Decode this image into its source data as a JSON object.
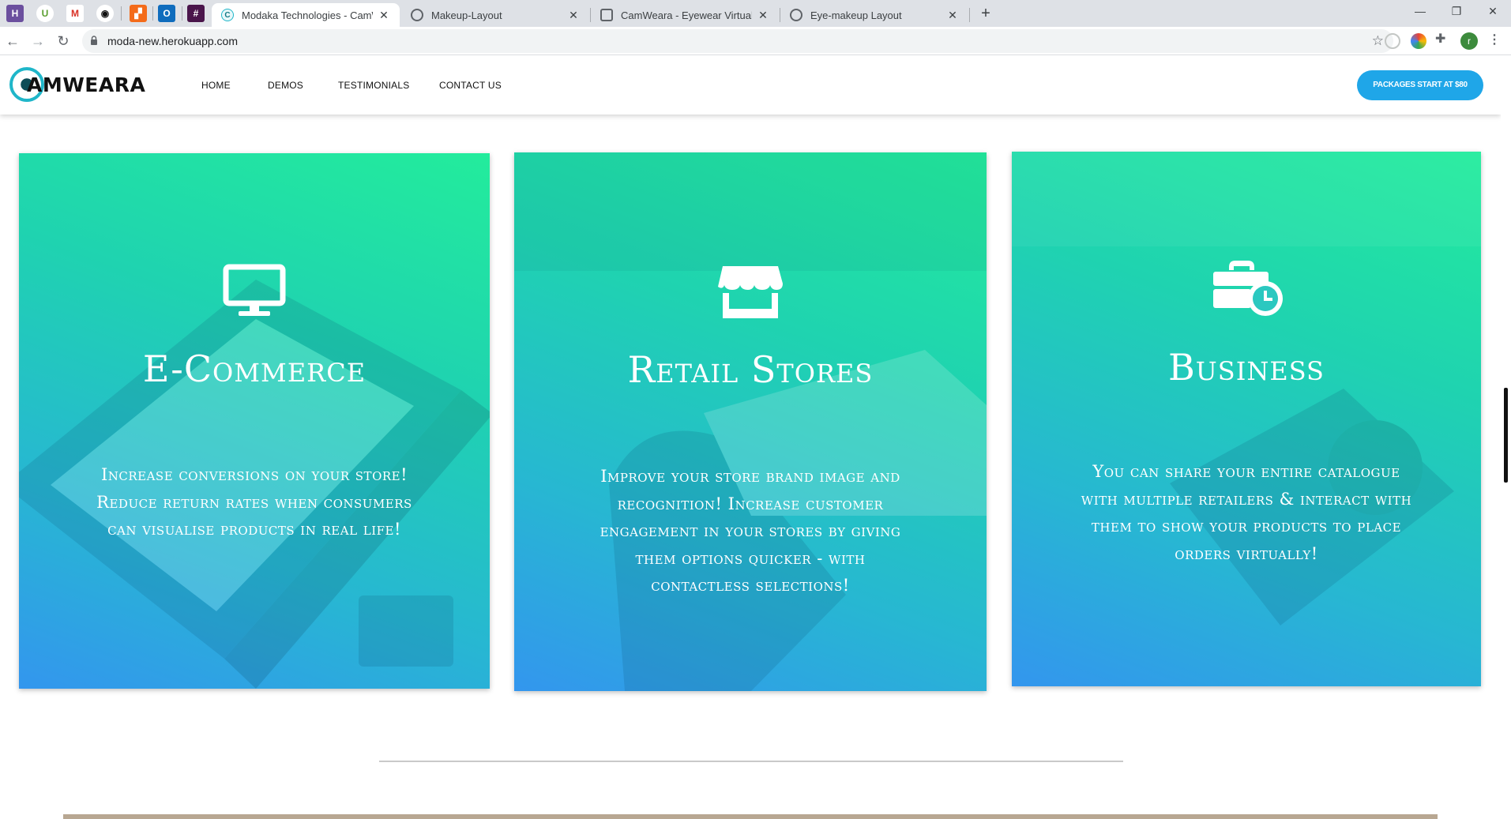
{
  "browser": {
    "tabs": [
      {
        "title": "Modaka Technologies - CamWeara",
        "active": true
      },
      {
        "title": "Makeup-Layout",
        "active": false
      },
      {
        "title": "CamWeara - Eyewear Virtual Try On",
        "active": false
      },
      {
        "title": "Eye-makeup Layout",
        "active": false
      }
    ],
    "url": "moda-new.herokuapp.com",
    "profile_initial": "r"
  },
  "site": {
    "logo_text": "AMWEARA",
    "nav": [
      "HOME",
      "DEMOS",
      "TESTIMONIALS",
      "CONTACT US"
    ],
    "cta_label": "PACKAGES START AT $80"
  },
  "cards": [
    {
      "icon": "monitor-icon",
      "title": "E-Commerce",
      "description": "Increase conversions on your store! Reduce return rates when consumers can visualise products in real life!"
    },
    {
      "icon": "store-icon",
      "title": "Retail Stores",
      "description": "Improve your store brand image and recognition! Increase customer engagement in your stores by giving them options quicker - with contactless selections!"
    },
    {
      "icon": "briefcase-clock-icon",
      "title": "Business",
      "description": "You can share your entire catalogue with multiple retailers & interact with them to show your products to place orders virtually!"
    }
  ],
  "colors": {
    "card_gradient_top": "#23ec9c",
    "card_gradient_bottom": "#3396ee",
    "cta_button": "#1fa6e8",
    "logo_accent": "#1fb6c9"
  }
}
